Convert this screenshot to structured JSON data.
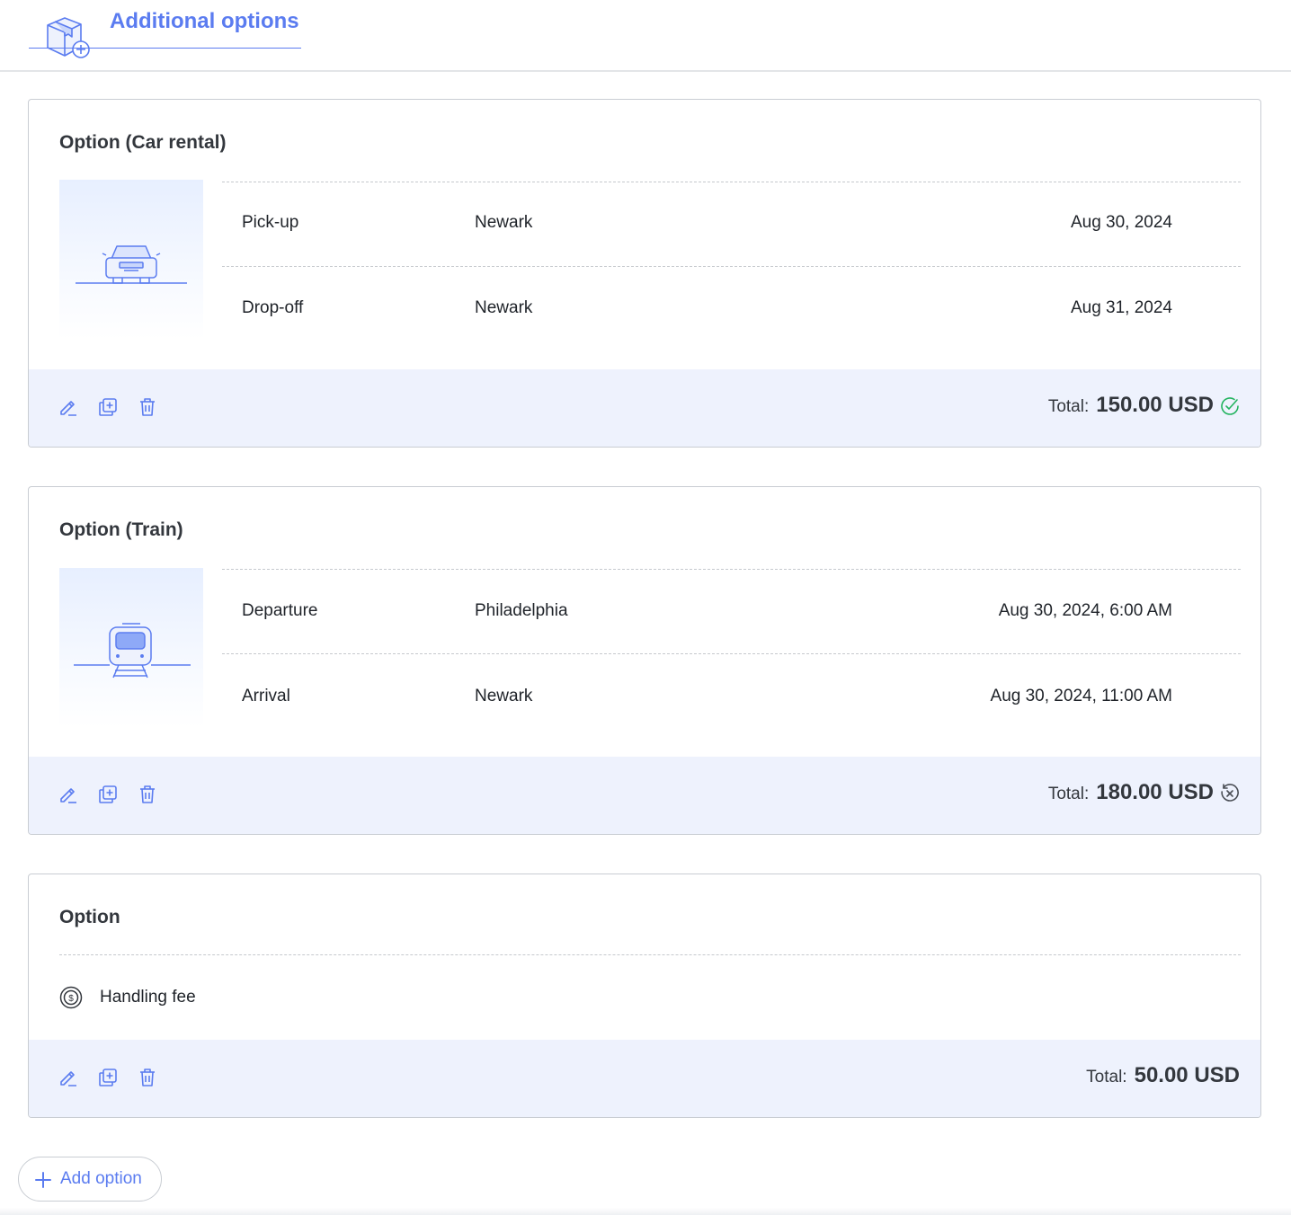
{
  "header": {
    "title": "Additional options",
    "icon": "box-plus-icon"
  },
  "colors": {
    "accent": "#5b7cf0",
    "footer_bg": "#eef2fd",
    "confirmed": "#22b35e",
    "neutral": "#4a4e55"
  },
  "cards": [
    {
      "title": "Option (Car rental)",
      "thumb_icon": "car-icon",
      "rows": [
        {
          "label": "Pick-up",
          "place": "Newark",
          "date": "Aug 30, 2024"
        },
        {
          "label": "Drop-off",
          "place": "Newark",
          "date": "Aug 31, 2024"
        }
      ],
      "total_label": "Total:",
      "total_value": "150.00 USD",
      "status_icon": "check-circle-icon"
    },
    {
      "title": "Option (Train)",
      "thumb_icon": "train-icon",
      "rows": [
        {
          "label": "Departure",
          "place": "Philadelphia",
          "date": "Aug 30, 2024, 6:00 AM"
        },
        {
          "label": "Arrival",
          "place": "Newark",
          "date": "Aug 30, 2024, 11:00 AM"
        }
      ],
      "total_label": "Total:",
      "total_value": "180.00 USD",
      "status_icon": "cancel-circle-icon"
    },
    {
      "title": "Option",
      "fee_icon": "coin-icon",
      "fee_label": "Handling fee",
      "total_label": "Total:",
      "total_value": "50.00 USD"
    }
  ],
  "actions": {
    "edit_icon": "pencil-icon",
    "duplicate_icon": "duplicate-icon",
    "delete_icon": "trash-icon"
  },
  "add_button": {
    "label": "Add option",
    "icon": "plus-icon"
  }
}
